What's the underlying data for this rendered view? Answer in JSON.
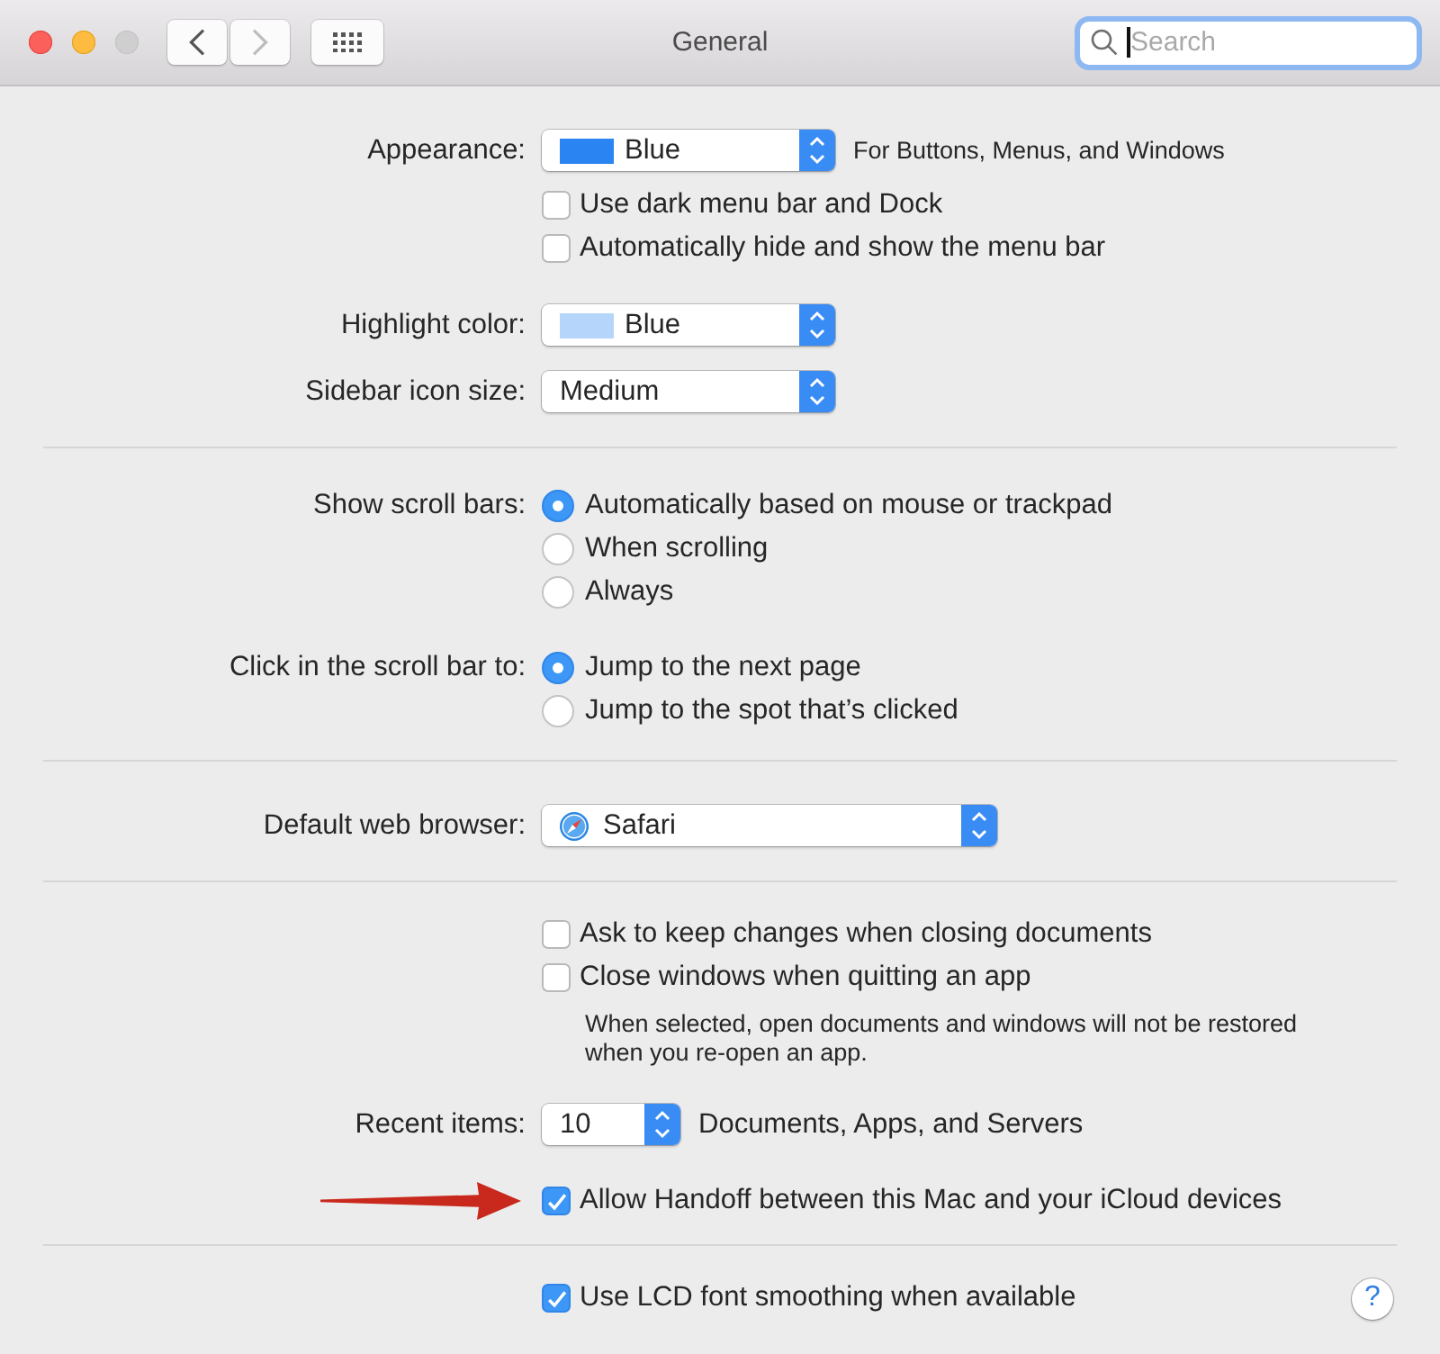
{
  "window": {
    "title": "General",
    "controls": [
      {
        "kind": "close",
        "color": "#fc605b"
      },
      {
        "kind": "minimize",
        "color": "#fdbc40"
      },
      {
        "kind": "zoom",
        "color": "#d0cfd0"
      }
    ]
  },
  "toolbar": {
    "nav": [
      {
        "kind": "back",
        "disabled": false
      },
      {
        "kind": "forward",
        "disabled": true
      }
    ],
    "search": {
      "placeholder": "Search",
      "focused": true
    }
  },
  "sections": [
    {
      "groups": [
        {
          "rows": [
            {
              "kind": "swatch-popup",
              "label": "Appearance:",
              "value": "Blue",
              "color": "#2a84f2",
              "hint": "For Buttons, Menus, and Windows"
            },
            {
              "kind": "checkbox",
              "text": "Use dark menu bar and Dock",
              "checked": false
            },
            {
              "kind": "checkbox",
              "text": "Automatically hide and show the menu bar",
              "checked": false
            }
          ]
        },
        {
          "rows": [
            {
              "kind": "swatch-popup",
              "label": "Highlight color:",
              "value": "Blue",
              "color": "#b5d5fb"
            },
            {
              "kind": "popup",
              "label": "Sidebar icon size:",
              "value": "Medium"
            }
          ]
        }
      ]
    },
    {
      "groups": [
        {
          "rows": [
            {
              "kind": "radio-group",
              "label": "Show scroll bars:",
              "options": [
                {
                  "text": "Automatically based on mouse or trackpad",
                  "selected": true
                },
                {
                  "text": "When scrolling",
                  "selected": false
                },
                {
                  "text": "Always",
                  "selected": false
                }
              ]
            }
          ]
        },
        {
          "rows": [
            {
              "kind": "radio-group",
              "label": "Click in the scroll bar to:",
              "options": [
                {
                  "text": "Jump to the next page",
                  "selected": true
                },
                {
                  "text": "Jump to the spot that’s clicked",
                  "selected": false
                }
              ]
            }
          ]
        }
      ]
    },
    {
      "groups": [
        {
          "rows": [
            {
              "kind": "app-popup",
              "label": "Default web browser:",
              "value": "Safari"
            }
          ]
        }
      ]
    },
    {
      "groups": [
        {
          "rows": [
            {
              "kind": "checkbox",
              "text": "Ask to keep changes when closing documents",
              "checked": false
            },
            {
              "kind": "checkbox",
              "text": "Close windows when quitting an app",
              "checked": false
            },
            {
              "kind": "note",
              "text": "When selected, open documents and windows will not be restored\nwhen you re-open an app."
            }
          ]
        },
        {
          "rows": [
            {
              "kind": "number-popup",
              "label": "Recent items:",
              "value": "10",
              "suffix": "Documents, Apps, and Servers"
            }
          ]
        },
        {
          "rows": [
            {
              "kind": "checkbox",
              "text": "Allow Handoff between this Mac and your iCloud devices",
              "checked": true,
              "arrow": true
            }
          ]
        }
      ]
    },
    {
      "groups": [
        {
          "rows": [
            {
              "kind": "checkbox",
              "text": "Use LCD font smoothing when available",
              "checked": true
            }
          ]
        }
      ],
      "help_button": "?"
    }
  ]
}
